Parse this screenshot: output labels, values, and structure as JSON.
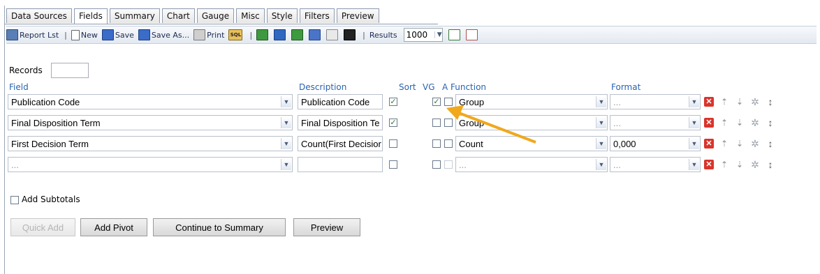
{
  "tabs": [
    "Data Sources",
    "Fields",
    "Summary",
    "Chart",
    "Gauge",
    "Misc",
    "Style",
    "Filters",
    "Preview"
  ],
  "toolbar": {
    "report_list": "Report Lst",
    "new": "New",
    "save": "Save",
    "save_as": "Save As...",
    "print": "Print",
    "sql": "SQL",
    "results_label": "Results",
    "results_value": "1000",
    "sep": "|"
  },
  "records_label": "Records",
  "headers": {
    "field": "Field",
    "description": "Description",
    "sort": "Sort",
    "vg": "VG",
    "a": "A",
    "function": "Function",
    "format": "Format"
  },
  "rows": [
    {
      "field": "Publication Code",
      "description": "Publication Code",
      "sort": true,
      "vg": true,
      "a": false,
      "function": "Group",
      "format": "..."
    },
    {
      "field": "Final Disposition Term",
      "description": "Final Disposition Te",
      "sort": true,
      "vg": false,
      "a": false,
      "function": "Group",
      "format": "..."
    },
    {
      "field": "First Decision Term",
      "description": "Count(First Decisior",
      "sort": false,
      "vg": false,
      "a": false,
      "function": "Count",
      "format": "0,000"
    },
    {
      "field": "...",
      "description": "",
      "sort": false,
      "vg": false,
      "a": false,
      "function": "...",
      "format": "..."
    }
  ],
  "add_subtotals_label": "Add Subtotals",
  "buttons": {
    "quick_add": "Quick Add",
    "add_pivot": "Add Pivot",
    "continue": "Continue to Summary",
    "preview": "Preview"
  },
  "annotation_color": "#f0a81c"
}
